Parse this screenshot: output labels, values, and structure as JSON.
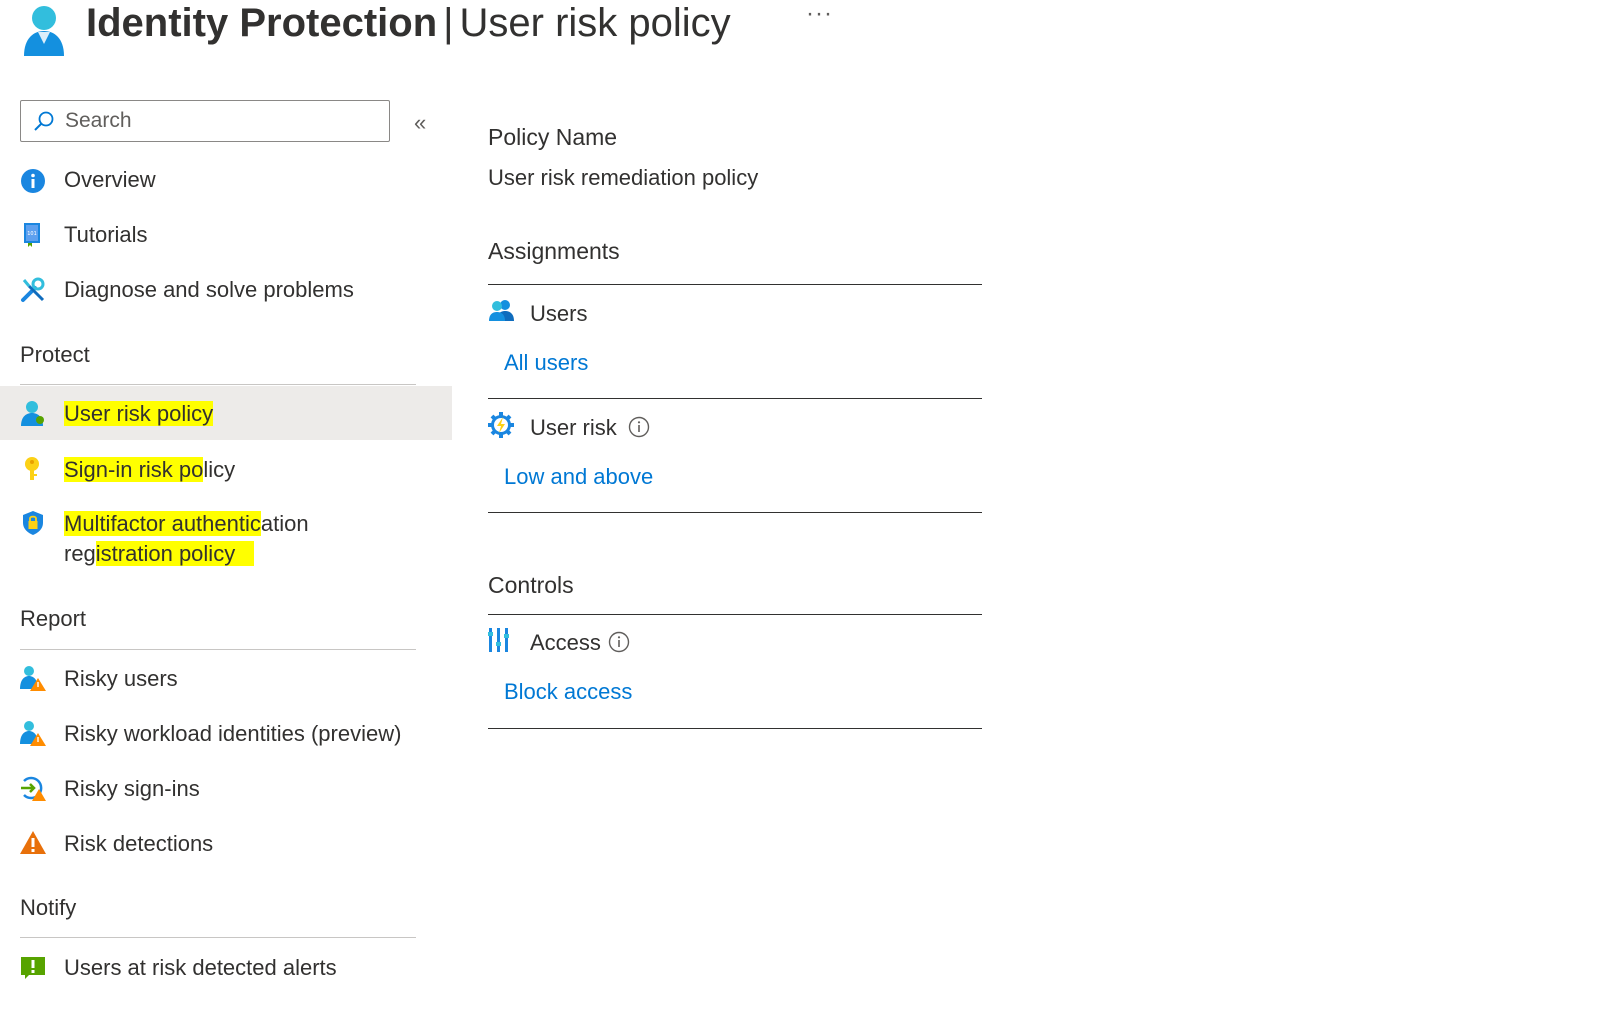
{
  "header": {
    "title_bold": "Identity Protection",
    "separator": "|",
    "title_sub": "User risk policy",
    "more_label": "···"
  },
  "sidebar": {
    "search": {
      "placeholder": "Search",
      "value": ""
    },
    "collapse_label": "«",
    "top_items": [
      {
        "label": "Overview",
        "icon": "info-icon"
      },
      {
        "label": "Tutorials",
        "icon": "book-icon"
      },
      {
        "label": "Diagnose and solve problems",
        "icon": "wrench-icon"
      }
    ],
    "sections": {
      "protect": {
        "title": "Protect",
        "items": [
          {
            "label": "User risk policy",
            "icon": "user-icon",
            "selected": true
          },
          {
            "label": "Sign-in risk policy",
            "icon": "key-icon"
          },
          {
            "label_line1": "Multifactor authentication",
            "label_line2": "registration policy",
            "icon": "shield-lock-icon"
          }
        ]
      },
      "report": {
        "title": "Report",
        "items": [
          {
            "label": "Risky users",
            "icon": "risky-user-icon"
          },
          {
            "label": "Risky workload identities (preview)",
            "icon": "risky-workload-icon"
          },
          {
            "label": "Risky sign-ins",
            "icon": "risky-signin-icon"
          },
          {
            "label": "Risk detections",
            "icon": "warning-icon"
          }
        ]
      },
      "notify": {
        "title": "Notify",
        "items": [
          {
            "label": "Users at risk detected alerts",
            "icon": "alert-icon"
          }
        ]
      }
    }
  },
  "main": {
    "policy_name_label": "Policy Name",
    "policy_name_value": "User risk remediation policy",
    "assignments_title": "Assignments",
    "users_label": "Users",
    "users_value": "All users",
    "user_risk_label": "User risk",
    "user_risk_value": "Low and above",
    "controls_title": "Controls",
    "access_label": "Access",
    "access_value": "Block access"
  },
  "colors": {
    "link": "#0078d4",
    "highlight": "#ffff00",
    "selected_bg": "#edebe9",
    "text": "#323130"
  }
}
